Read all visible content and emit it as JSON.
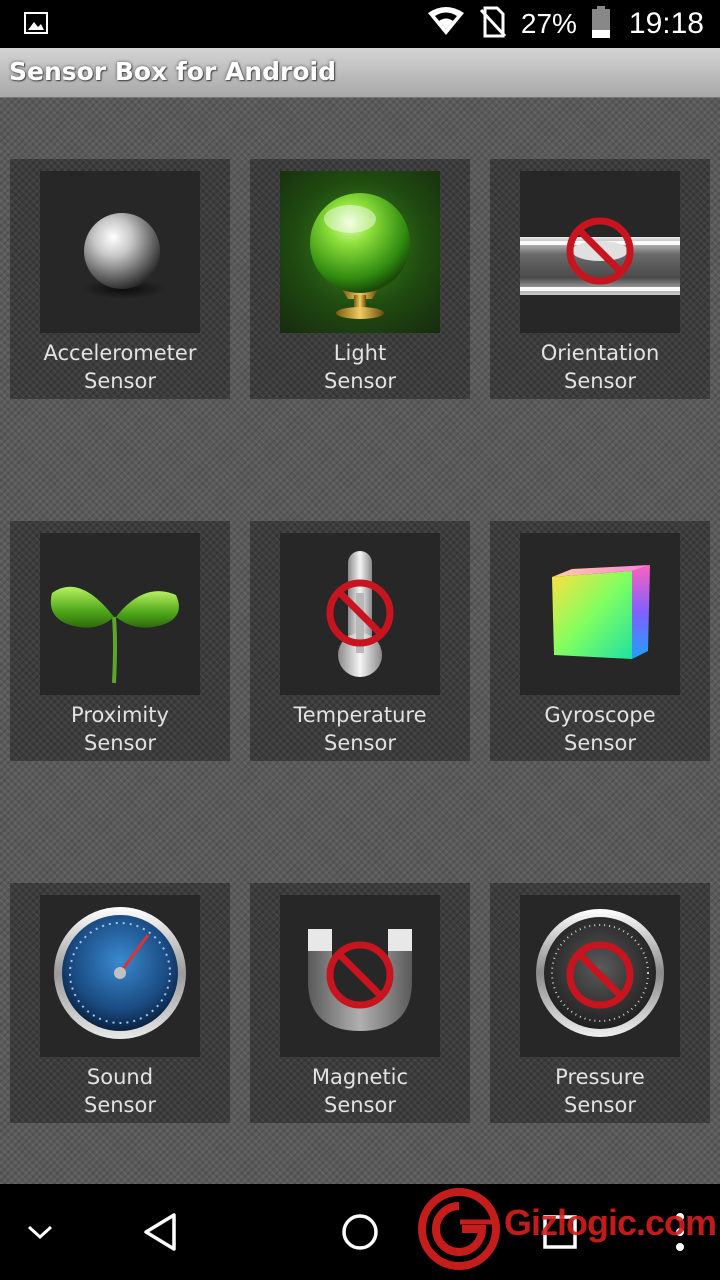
{
  "status_bar": {
    "battery_percent": "27%",
    "time": "19:18"
  },
  "app": {
    "title": "Sensor Box for Android"
  },
  "sensors": [
    {
      "line1": "Accelerometer",
      "line2": "Sensor",
      "icon": "metal-ball-icon",
      "available": true
    },
    {
      "line1": "Light",
      "line2": "Sensor",
      "icon": "crystal-ball-icon",
      "available": true
    },
    {
      "line1": "Orientation",
      "line2": "Sensor",
      "icon": "spirit-level-icon",
      "available": false
    },
    {
      "line1": "Proximity",
      "line2": "Sensor",
      "icon": "sprout-icon",
      "available": true
    },
    {
      "line1": "Temperature",
      "line2": "Sensor",
      "icon": "thermometer-icon",
      "available": false
    },
    {
      "line1": "Gyroscope",
      "line2": "Sensor",
      "icon": "color-cube-icon",
      "available": true
    },
    {
      "line1": "Sound",
      "line2": "Sensor",
      "icon": "speedometer-icon",
      "available": true
    },
    {
      "line1": "Magnetic",
      "line2": "Sensor",
      "icon": "magnet-icon",
      "available": false
    },
    {
      "line1": "Pressure",
      "line2": "Sensor",
      "icon": "pressure-gauge-icon",
      "available": false
    }
  ],
  "watermark": {
    "text": "Gizlogic.com"
  },
  "colors": {
    "unavailable_sign": "#c8141e",
    "title_bar": "#bdbdbd",
    "background": "#5a5a5a"
  }
}
